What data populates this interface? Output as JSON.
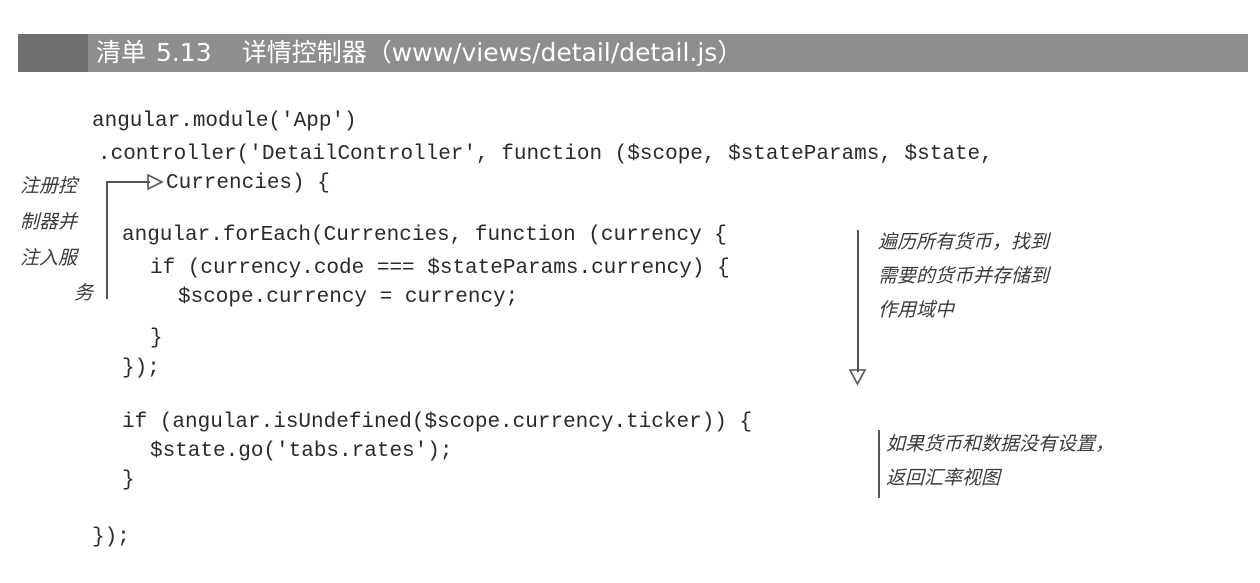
{
  "listing": {
    "label": "清单",
    "number": "5.13",
    "title": "详情控制器（www/views/detail/detail.js）"
  },
  "code_lines": [
    "angular.module('App')",
    ".controller('DetailController', function ($scope, $stateParams, $state,",
    "Currencies) {",
    "angular.forEach(Currencies, function (currency {",
    "if (currency.code === $stateParams.currency) {",
    "$scope.currency = currency;",
    "}",
    "});",
    "if (angular.isUndefined($scope.currency.ticker)) {",
    "$state.go('tabs.rates');",
    "}",
    "});"
  ],
  "annotations": {
    "inject": [
      "注册控",
      "制器并",
      "注入服",
      "务"
    ],
    "loop": [
      "遍历所有货币，找到",
      "需要的货币并存储到",
      "作用域中"
    ],
    "fallback": [
      "如果货币和数据没有设置，",
      "返回汇率视图"
    ]
  }
}
